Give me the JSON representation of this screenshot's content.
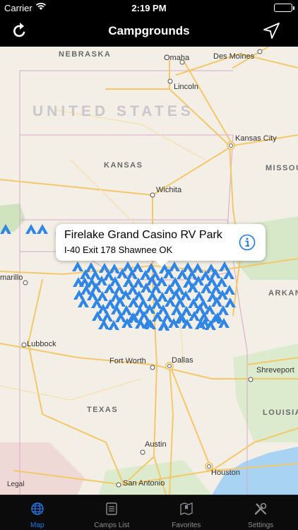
{
  "status_bar": {
    "carrier": "Carrier",
    "time": "2:19 PM"
  },
  "nav": {
    "title": "Campgrounds",
    "left_icon": "refresh-icon",
    "right_icon": "location-arrow-icon"
  },
  "map": {
    "country": "UNITED STATES",
    "states": [
      "NEBRASKA",
      "KANSAS",
      "MISSOU",
      "ARKAN",
      "TEXAS",
      "LOUISIA"
    ],
    "cities": [
      "Omaha",
      "Des Moines",
      "Lincoln",
      "Kansas City",
      "Wichita",
      "marillo",
      "Lubbock",
      "Fort Worth",
      "Dallas",
      "Shreveport",
      "Austin",
      "Houston",
      "San Antonio"
    ],
    "legal": "Legal",
    "colors": {
      "land": "#f3efe6",
      "road": "#f4c86a",
      "water": "#a9d3f2",
      "pin": "#2f86e6"
    }
  },
  "callout": {
    "name": "Firelake Grand Casino RV Park",
    "address": "I-40 Exit 178 Shawnee OK",
    "info_icon": "info-circle-icon"
  },
  "tabs": [
    {
      "label": "Map",
      "icon": "globe-icon",
      "active": true
    },
    {
      "label": "Camps List",
      "icon": "list-icon",
      "active": false
    },
    {
      "label": "Favorites",
      "icon": "map-bookmark-icon",
      "active": false
    },
    {
      "label": "Settings",
      "icon": "tools-icon",
      "active": false
    }
  ],
  "accent": "#1e78e8"
}
